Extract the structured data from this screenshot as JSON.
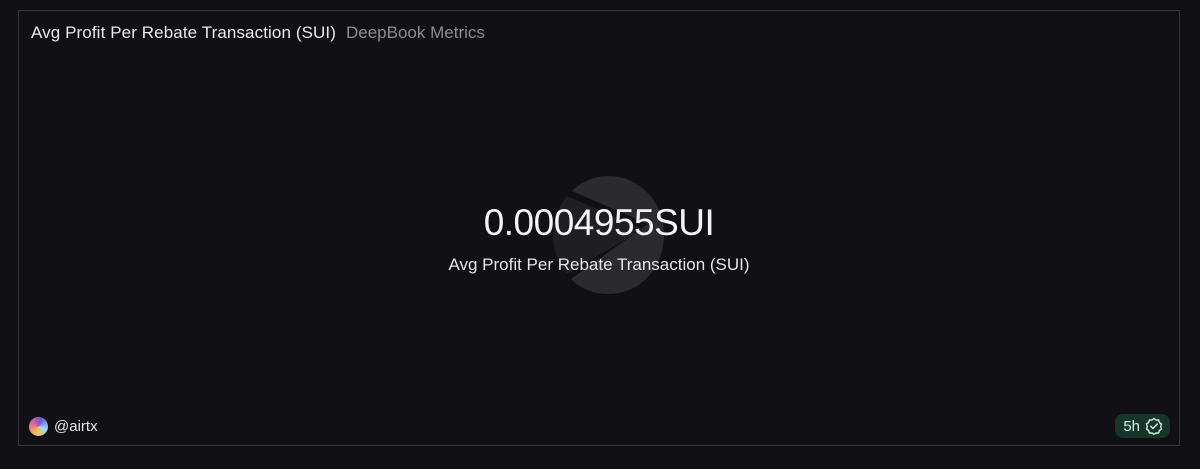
{
  "header": {
    "title": "Avg Profit Per Rebate Transaction (SUI)",
    "subtitle": "DeepBook Metrics"
  },
  "counter": {
    "value": "0.0004955SUI",
    "label": "Avg Profit Per Rebate Transaction (SUI)"
  },
  "footer": {
    "author": "@airtx",
    "freshness": "5h",
    "freshness_icon": "verified-check-icon",
    "avatar_icon": "avatar"
  },
  "colors": {
    "background": "#111014",
    "freshness_badge": "#17352b",
    "freshness_text": "#cfeede"
  }
}
